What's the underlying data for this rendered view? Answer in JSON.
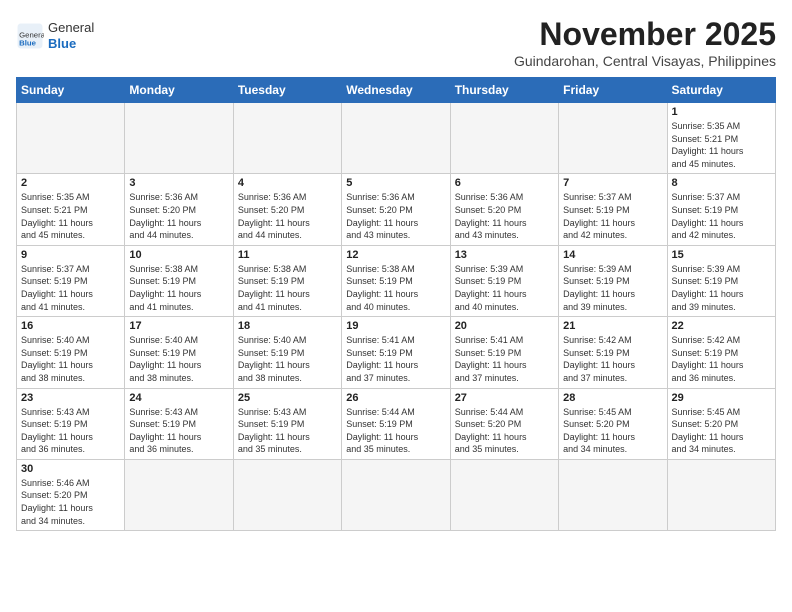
{
  "header": {
    "logo_general": "General",
    "logo_blue": "Blue",
    "month_year": "November 2025",
    "location": "Guindarohan, Central Visayas, Philippines"
  },
  "weekdays": [
    "Sunday",
    "Monday",
    "Tuesday",
    "Wednesday",
    "Thursday",
    "Friday",
    "Saturday"
  ],
  "weeks": [
    [
      {
        "day": "",
        "info": ""
      },
      {
        "day": "",
        "info": ""
      },
      {
        "day": "",
        "info": ""
      },
      {
        "day": "",
        "info": ""
      },
      {
        "day": "",
        "info": ""
      },
      {
        "day": "",
        "info": ""
      },
      {
        "day": "1",
        "info": "Sunrise: 5:35 AM\nSunset: 5:21 PM\nDaylight: 11 hours\nand 45 minutes."
      }
    ],
    [
      {
        "day": "2",
        "info": "Sunrise: 5:35 AM\nSunset: 5:21 PM\nDaylight: 11 hours\nand 45 minutes."
      },
      {
        "day": "3",
        "info": "Sunrise: 5:36 AM\nSunset: 5:20 PM\nDaylight: 11 hours\nand 44 minutes."
      },
      {
        "day": "4",
        "info": "Sunrise: 5:36 AM\nSunset: 5:20 PM\nDaylight: 11 hours\nand 44 minutes."
      },
      {
        "day": "5",
        "info": "Sunrise: 5:36 AM\nSunset: 5:20 PM\nDaylight: 11 hours\nand 43 minutes."
      },
      {
        "day": "6",
        "info": "Sunrise: 5:36 AM\nSunset: 5:20 PM\nDaylight: 11 hours\nand 43 minutes."
      },
      {
        "day": "7",
        "info": "Sunrise: 5:37 AM\nSunset: 5:19 PM\nDaylight: 11 hours\nand 42 minutes."
      },
      {
        "day": "8",
        "info": "Sunrise: 5:37 AM\nSunset: 5:19 PM\nDaylight: 11 hours\nand 42 minutes."
      }
    ],
    [
      {
        "day": "9",
        "info": "Sunrise: 5:37 AM\nSunset: 5:19 PM\nDaylight: 11 hours\nand 41 minutes."
      },
      {
        "day": "10",
        "info": "Sunrise: 5:38 AM\nSunset: 5:19 PM\nDaylight: 11 hours\nand 41 minutes."
      },
      {
        "day": "11",
        "info": "Sunrise: 5:38 AM\nSunset: 5:19 PM\nDaylight: 11 hours\nand 41 minutes."
      },
      {
        "day": "12",
        "info": "Sunrise: 5:38 AM\nSunset: 5:19 PM\nDaylight: 11 hours\nand 40 minutes."
      },
      {
        "day": "13",
        "info": "Sunrise: 5:39 AM\nSunset: 5:19 PM\nDaylight: 11 hours\nand 40 minutes."
      },
      {
        "day": "14",
        "info": "Sunrise: 5:39 AM\nSunset: 5:19 PM\nDaylight: 11 hours\nand 39 minutes."
      },
      {
        "day": "15",
        "info": "Sunrise: 5:39 AM\nSunset: 5:19 PM\nDaylight: 11 hours\nand 39 minutes."
      }
    ],
    [
      {
        "day": "16",
        "info": "Sunrise: 5:40 AM\nSunset: 5:19 PM\nDaylight: 11 hours\nand 38 minutes."
      },
      {
        "day": "17",
        "info": "Sunrise: 5:40 AM\nSunset: 5:19 PM\nDaylight: 11 hours\nand 38 minutes."
      },
      {
        "day": "18",
        "info": "Sunrise: 5:40 AM\nSunset: 5:19 PM\nDaylight: 11 hours\nand 38 minutes."
      },
      {
        "day": "19",
        "info": "Sunrise: 5:41 AM\nSunset: 5:19 PM\nDaylight: 11 hours\nand 37 minutes."
      },
      {
        "day": "20",
        "info": "Sunrise: 5:41 AM\nSunset: 5:19 PM\nDaylight: 11 hours\nand 37 minutes."
      },
      {
        "day": "21",
        "info": "Sunrise: 5:42 AM\nSunset: 5:19 PM\nDaylight: 11 hours\nand 37 minutes."
      },
      {
        "day": "22",
        "info": "Sunrise: 5:42 AM\nSunset: 5:19 PM\nDaylight: 11 hours\nand 36 minutes."
      }
    ],
    [
      {
        "day": "23",
        "info": "Sunrise: 5:43 AM\nSunset: 5:19 PM\nDaylight: 11 hours\nand 36 minutes."
      },
      {
        "day": "24",
        "info": "Sunrise: 5:43 AM\nSunset: 5:19 PM\nDaylight: 11 hours\nand 36 minutes."
      },
      {
        "day": "25",
        "info": "Sunrise: 5:43 AM\nSunset: 5:19 PM\nDaylight: 11 hours\nand 35 minutes."
      },
      {
        "day": "26",
        "info": "Sunrise: 5:44 AM\nSunset: 5:19 PM\nDaylight: 11 hours\nand 35 minutes."
      },
      {
        "day": "27",
        "info": "Sunrise: 5:44 AM\nSunset: 5:20 PM\nDaylight: 11 hours\nand 35 minutes."
      },
      {
        "day": "28",
        "info": "Sunrise: 5:45 AM\nSunset: 5:20 PM\nDaylight: 11 hours\nand 34 minutes."
      },
      {
        "day": "29",
        "info": "Sunrise: 5:45 AM\nSunset: 5:20 PM\nDaylight: 11 hours\nand 34 minutes."
      }
    ],
    [
      {
        "day": "30",
        "info": "Sunrise: 5:46 AM\nSunset: 5:20 PM\nDaylight: 11 hours\nand 34 minutes."
      },
      {
        "day": "",
        "info": ""
      },
      {
        "day": "",
        "info": ""
      },
      {
        "day": "",
        "info": ""
      },
      {
        "day": "",
        "info": ""
      },
      {
        "day": "",
        "info": ""
      },
      {
        "day": "",
        "info": ""
      }
    ]
  ]
}
